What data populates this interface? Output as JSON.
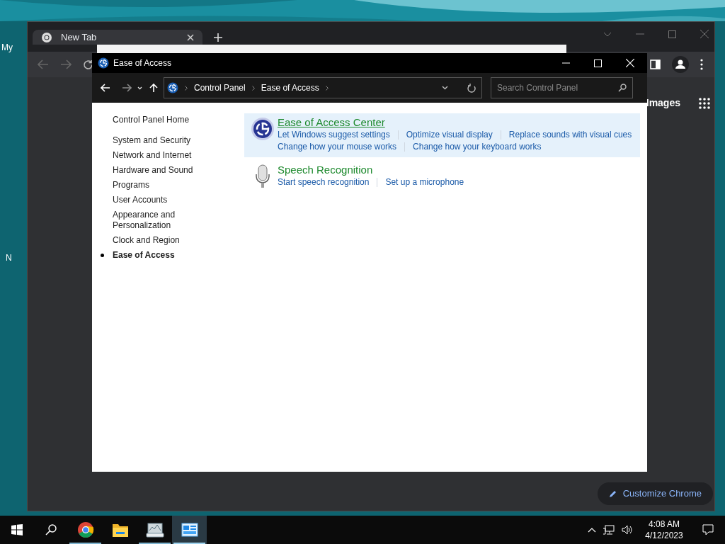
{
  "desktop": {
    "icon_labels": [
      "My",
      "N"
    ]
  },
  "browser": {
    "tabs": [
      {
        "label": "New Tab",
        "selected": true
      }
    ],
    "content_link": "Images",
    "customize_button": "Customize Chrome"
  },
  "window": {
    "title": "Ease of Access",
    "breadcrumb": [
      "Control Panel",
      "Ease of Access"
    ],
    "search": {
      "placeholder": "Search Control Panel"
    }
  },
  "sidebar": {
    "items": [
      {
        "label": "Control Panel Home",
        "kind": "home",
        "selected": false
      },
      {
        "label": "System and Security",
        "kind": "category",
        "selected": false
      },
      {
        "label": "Network and Internet",
        "kind": "category",
        "selected": false
      },
      {
        "label": "Hardware and Sound",
        "kind": "category",
        "selected": false
      },
      {
        "label": "Programs",
        "kind": "category",
        "selected": false
      },
      {
        "label": "User Accounts",
        "kind": "category",
        "selected": false
      },
      {
        "label": "Appearance and Personalization",
        "kind": "category",
        "selected": false
      },
      {
        "label": "Clock and Region",
        "kind": "category",
        "selected": false
      },
      {
        "label": "Ease of Access",
        "kind": "category",
        "selected": true
      }
    ]
  },
  "categories": [
    {
      "kind": "accessibility",
      "title": "Ease of Access Center",
      "highlighted": true,
      "link_rows": [
        [
          "Let Windows suggest settings",
          "Optimize visual display",
          "Replace sounds with visual cues"
        ],
        [
          "Change how your mouse works",
          "Change how your keyboard works"
        ]
      ]
    },
    {
      "kind": "speech",
      "title": "Speech Recognition",
      "highlighted": false,
      "link_rows": [
        [
          "Start speech recognition",
          "Set up a microphone"
        ]
      ]
    }
  ],
  "taskbar": {
    "apps": [
      {
        "kind": "chrome",
        "running": true,
        "selected": false
      },
      {
        "kind": "explorer",
        "running": false,
        "selected": false
      },
      {
        "kind": "monitor",
        "running": true,
        "selected": false
      },
      {
        "kind": "control-panel",
        "running": true,
        "selected": true
      }
    ],
    "clock": {
      "time": "4:08 AM",
      "date": "4/12/2023"
    }
  }
}
